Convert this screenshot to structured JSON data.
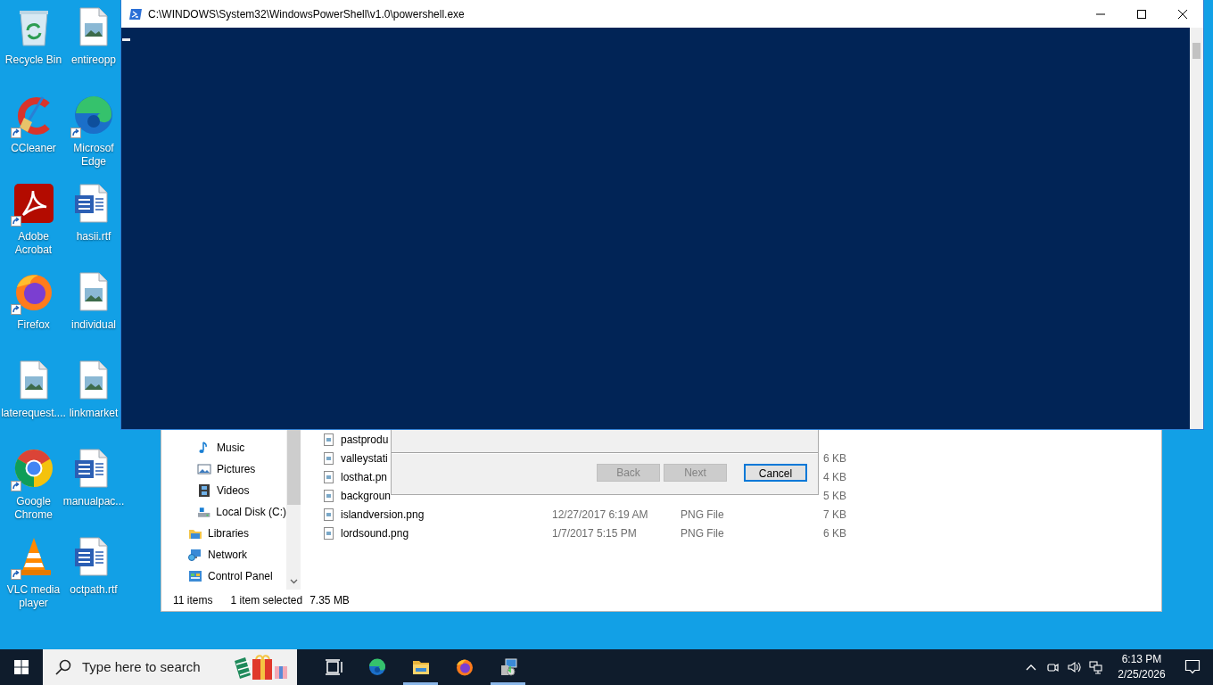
{
  "desktop_icons": [
    {
      "label": "Recycle Bin",
      "kind": "recycle",
      "shortcut": false
    },
    {
      "label": "CCleaner",
      "kind": "cleaner",
      "shortcut": true
    },
    {
      "label": "Adobe Acrobat",
      "kind": "pdf",
      "shortcut": true
    },
    {
      "label": "Firefox",
      "kind": "firefox",
      "shortcut": true
    },
    {
      "label": "laterequest....",
      "kind": "image",
      "shortcut": false
    },
    {
      "label": "Google Chrome",
      "kind": "chrome",
      "shortcut": true
    },
    {
      "label": "VLC media player",
      "kind": "cone",
      "shortcut": true
    },
    {
      "label": "entireopp",
      "kind": "image",
      "shortcut": false
    },
    {
      "label": "Microsof Edge",
      "kind": "edge",
      "shortcut": true
    },
    {
      "label": "hasii.rtf",
      "kind": "doc",
      "shortcut": false
    },
    {
      "label": "individual",
      "kind": "image",
      "shortcut": false
    },
    {
      "label": "linkmarket",
      "kind": "image",
      "shortcut": false
    },
    {
      "label": "manualpac...",
      "kind": "doc",
      "shortcut": false
    },
    {
      "label": "octpath.rtf",
      "kind": "doc",
      "shortcut": false
    }
  ],
  "explorer": {
    "nav_tree": [
      {
        "children": [
          {
            "label": "Music",
            "kind": "music"
          },
          {
            "label": "Pictures",
            "kind": "pictures"
          },
          {
            "label": "Videos",
            "kind": "videos"
          },
          {
            "label": "Local Disk (C:)",
            "kind": "drive"
          }
        ]
      },
      {
        "label": "Libraries",
        "kind": "libraries"
      },
      {
        "label": "Network",
        "kind": "network"
      },
      {
        "label": "Control Panel",
        "kind": "control"
      }
    ],
    "files": [
      {
        "name": "pastprodu"
      },
      {
        "name": "valleystati",
        "size": "6 KB"
      },
      {
        "name": "losthat.pn",
        "size": "4 KB"
      },
      {
        "name": "backgroun",
        "size": "5 KB"
      },
      {
        "name": "islandversion.png",
        "modified": "12/27/2017 6:19 AM",
        "type": "PNG File",
        "size": "7 KB"
      },
      {
        "name": "lordsound.png",
        "modified": "1/7/2017 5:15 PM",
        "type": "PNG File",
        "size": "6 KB"
      }
    ],
    "status": {
      "count": "11 items",
      "selection": "1 item selected",
      "selection_size": "7.35 MB"
    }
  },
  "dialog": {
    "buttons": [
      {
        "label": "Back",
        "disabled": true,
        "default": false
      },
      {
        "label": "Next",
        "disabled": true,
        "default": false
      },
      {
        "label": "Cancel",
        "disabled": false,
        "default": true
      }
    ]
  },
  "console": {
    "title": "C:\\WINDOWS\\System32\\WindowsPowerShell\\v1.0\\powershell.exe"
  },
  "taskbar": {
    "search_placeholder": "Type here to search",
    "apps": [
      {
        "kind": "taskview",
        "running": false
      },
      {
        "kind": "edge",
        "running": false
      },
      {
        "kind": "folder",
        "running": true
      },
      {
        "kind": "firefox",
        "running": false
      },
      {
        "kind": "installer",
        "running": true
      }
    ],
    "time": "6:13 PM",
    "date": "2/25/2026"
  }
}
